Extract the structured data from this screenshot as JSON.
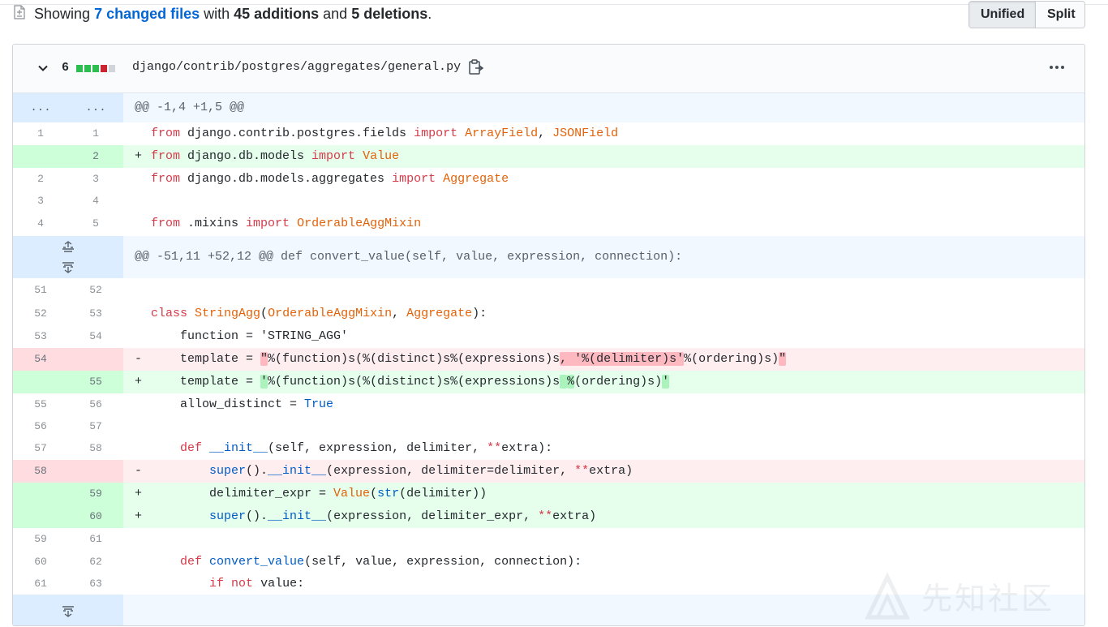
{
  "summary": {
    "prefix": "Showing ",
    "changed_files": "7 changed files",
    "with": " with ",
    "additions": "45 additions",
    "and": " and ",
    "deletions": "5 deletions",
    "suffix": "."
  },
  "view_toggle": {
    "unified": "Unified",
    "split": "Split",
    "selected": "Unified"
  },
  "file": {
    "change_count": "6",
    "stat_colors": [
      "#2cbe4e",
      "#2cbe4e",
      "#2cbe4e",
      "#cb2431",
      "#d1d5da"
    ],
    "path": "django/contrib/postgres/aggregates/general.py",
    "icons": {
      "collapse": "chevron-down-icon",
      "copy": "clipboard-icon",
      "menu": "kebab-icon"
    }
  },
  "diff": {
    "hunk1": {
      "old": "...",
      "new": "...",
      "header": "@@ -1,4 +1,5 @@"
    },
    "lines_a": [
      {
        "old": "1",
        "new": "1",
        "type": "ctx"
      },
      {
        "old": "",
        "new": "2",
        "type": "add"
      },
      {
        "old": "2",
        "new": "3",
        "type": "ctx"
      },
      {
        "old": "3",
        "new": "4",
        "type": "ctx"
      },
      {
        "old": "4",
        "new": "5",
        "type": "ctx"
      }
    ],
    "code": {
      "l1": {
        "kw1": "from",
        "mod": " django.contrib.postgres.fields ",
        "kw2": "import",
        "c1": "ArrayField",
        "sep": ", ",
        "c2": "JSONField"
      },
      "l2": {
        "sign": "+",
        "kw1": "from",
        "mod": " django.db.models ",
        "kw2": "import",
        "c1": "Value"
      },
      "l3": {
        "kw1": "from",
        "mod": " django.db.models.aggregates ",
        "kw2": "import",
        "c1": "Aggregate"
      },
      "l5": {
        "kw1": "from",
        "mod": " .mixins ",
        "kw2": "import",
        "c1": "OrderableAggMixin"
      },
      "hunk2": "@@ -51,11 +52,12 @@ def convert_value(self, value, expression, connection):",
      "c52": {
        "kw": "class",
        "name": "StringAgg",
        "open": "(",
        "b1": "OrderableAggMixin",
        "sep": ", ",
        "b2": "Aggregate",
        "close": "):"
      },
      "c53": {
        "text": "    function = 'STRING_AGG'"
      },
      "d54": {
        "sign": "-",
        "pre": "    template = ",
        "q1": "\"",
        "mid": "%(function)s(%(distinct)s%(expressions)s",
        "hl": ", '%(delimiter)s'",
        "rest": "%(ordering)s)",
        "q2": "\""
      },
      "a55": {
        "sign": "+",
        "pre": "    template = ",
        "q1": "'",
        "mid": "%(function)s(%(distinct)s%(expressions)s",
        "hl": " ",
        "hl2": "%",
        "rest": "(ordering)s)",
        "q2": "'"
      },
      "c56": {
        "pre": "    allow_distinct = ",
        "val": "True"
      },
      "c58": {
        "pre": "    ",
        "kw": "def",
        "name": " __init__",
        "rest": "(self, expression, delimiter, ",
        "op": "**",
        "tail": "extra):"
      },
      "d58": {
        "sign": "-",
        "pre": "        ",
        "sup": "super",
        "m1": "().",
        "init": "__init__",
        "rest": "(expression, delimiter=delimiter, ",
        "op": "**",
        "tail": "extra)"
      },
      "a59": {
        "sign": "+",
        "pre": "        delimiter_expr = ",
        "val": "Value",
        "p1": "(",
        "str": "str",
        "rest": "(delimiter))"
      },
      "a60": {
        "sign": "+",
        "pre": "        ",
        "sup": "super",
        "m1": "().",
        "init": "__init__",
        "rest": "(expression, delimiter_expr, ",
        "op": "**",
        "tail": "extra)"
      },
      "c62": {
        "pre": "    ",
        "kw": "def",
        "name": " convert_value",
        "rest": "(self, value, expression, connection):"
      },
      "c63": {
        "pre": "        ",
        "kw1": "if",
        "sp": " ",
        "kw2": "not",
        "rest": " value:"
      }
    },
    "lines_b": [
      {
        "old": "51",
        "new": "52"
      },
      {
        "old": "52",
        "new": "53"
      },
      {
        "old": "53",
        "new": "54"
      },
      {
        "old": "54",
        "new": ""
      },
      {
        "old": "",
        "new": "55"
      },
      {
        "old": "55",
        "new": "56"
      },
      {
        "old": "56",
        "new": "57"
      },
      {
        "old": "57",
        "new": "58"
      },
      {
        "old": "58",
        "new": ""
      },
      {
        "old": "",
        "new": "59"
      },
      {
        "old": "",
        "new": "60"
      },
      {
        "old": "59",
        "new": "61"
      },
      {
        "old": "60",
        "new": "62"
      },
      {
        "old": "61",
        "new": "63"
      }
    ]
  },
  "watermark": {
    "text": "先知社区"
  }
}
